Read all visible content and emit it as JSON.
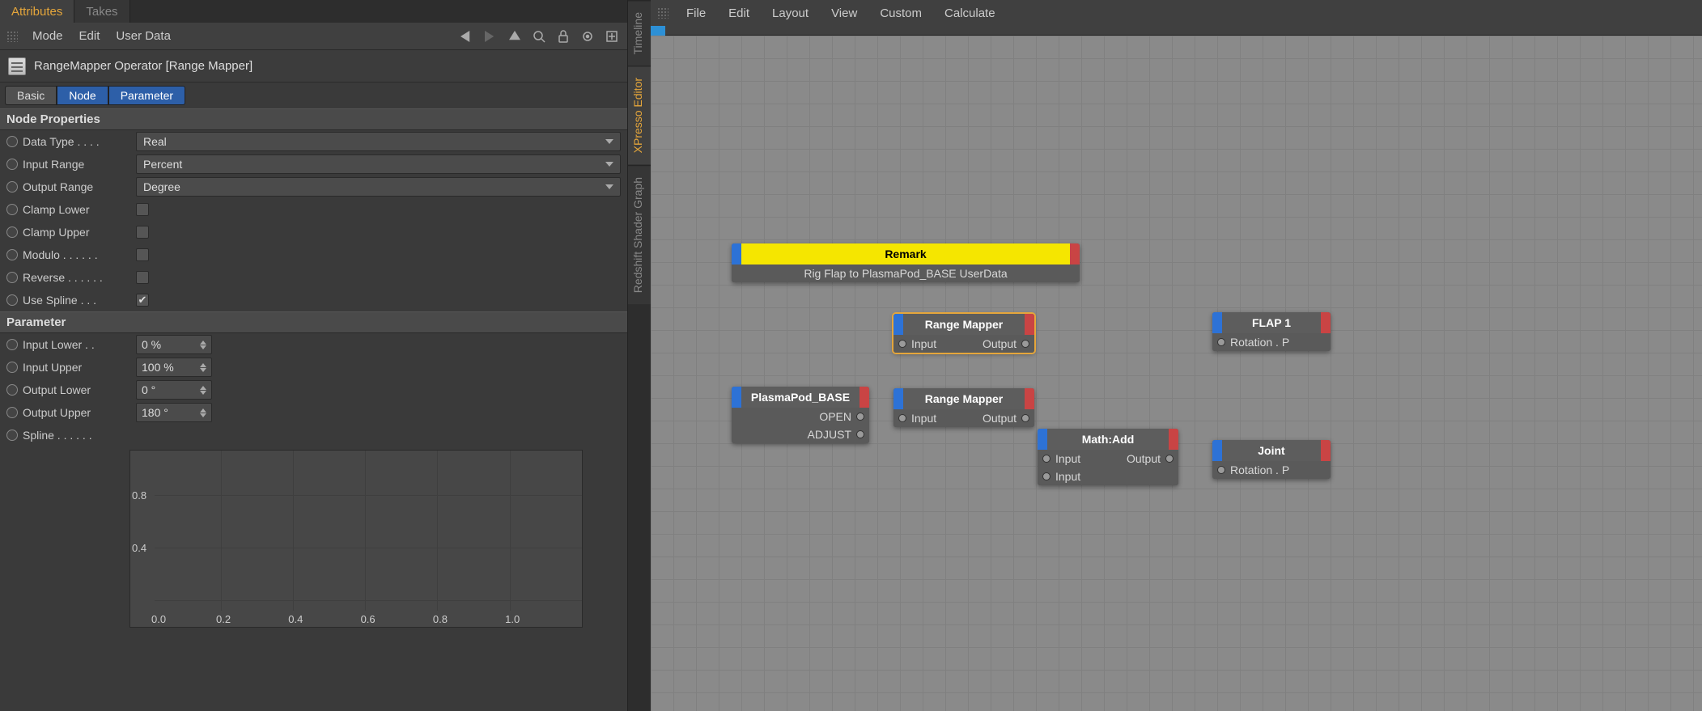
{
  "tabs": {
    "attributes": "Attributes",
    "takes": "Takes"
  },
  "toolbar": {
    "mode": "Mode",
    "edit": "Edit",
    "user_data": "User Data"
  },
  "object": {
    "title": "RangeMapper Operator [Range Mapper]"
  },
  "subtabs": {
    "basic": "Basic",
    "node": "Node",
    "parameter": "Parameter"
  },
  "sections": {
    "node_props": "Node Properties",
    "parameter": "Parameter"
  },
  "props": {
    "data_type": {
      "label": "Data Type . . . .",
      "value": "Real"
    },
    "input_range": {
      "label": "Input Range",
      "value": "Percent"
    },
    "output_range": {
      "label": "Output Range",
      "value": "Degree"
    },
    "clamp_lower": {
      "label": "Clamp Lower",
      "checked": false
    },
    "clamp_upper": {
      "label": "Clamp Upper",
      "checked": false
    },
    "modulo": {
      "label": "Modulo . . . . . .",
      "checked": false
    },
    "reverse": {
      "label": "Reverse . . . . . .",
      "checked": false
    },
    "use_spline": {
      "label": "Use Spline . . .",
      "checked": true
    },
    "input_lower": {
      "label": "Input Lower . .",
      "value": "0 %"
    },
    "input_upper": {
      "label": "Input Upper",
      "value": "100 %"
    },
    "output_lower": {
      "label": "Output Lower",
      "value": "0 °"
    },
    "output_upper": {
      "label": "Output Upper",
      "value": "180 °"
    },
    "spline": {
      "label": "Spline . . . . . ."
    }
  },
  "spline_axis_x": [
    "0.0",
    "0.2",
    "0.4",
    "0.6",
    "0.8",
    "1.0"
  ],
  "spline_axis_y": [
    "0.8",
    "0.4",
    ""
  ],
  "side_tabs": {
    "timeline": "Timeline",
    "xpresso": "XPresso Editor",
    "redshift": "Redshift Shader Graph"
  },
  "menubar": [
    "File",
    "Edit",
    "Layout",
    "View",
    "Custom",
    "Calculate"
  ],
  "nodes": {
    "remark": {
      "title": "Remark",
      "text": "Rig Flap to PlasmaPod_BASE UserData"
    },
    "rm1": {
      "title": "Range Mapper",
      "in": "Input",
      "out": "Output"
    },
    "rm2": {
      "title": "Range Mapper",
      "in": "Input",
      "out": "Output"
    },
    "base": {
      "title": "PlasmaPod_BASE",
      "p1": "OPEN",
      "p2": "ADJUST"
    },
    "math": {
      "title": "Math:Add",
      "in": "Input",
      "out": "Output"
    },
    "flap": {
      "title": "FLAP 1",
      "p": "Rotation . P"
    },
    "joint": {
      "title": "Joint",
      "p": "Rotation . P"
    }
  }
}
